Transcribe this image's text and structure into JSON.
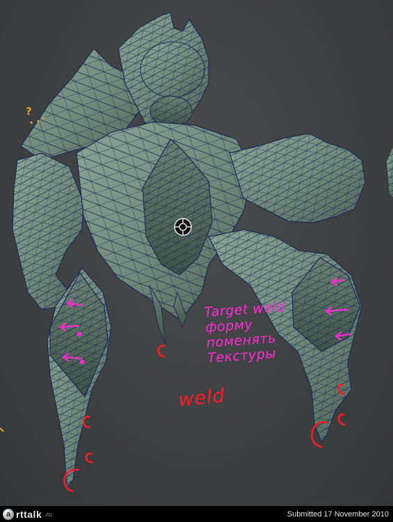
{
  "annotations": {
    "question_mark": "?",
    "target_weld_lines": [
      "Target weld",
      "форму",
      "поменять",
      "Текстуры"
    ],
    "weld": "weld",
    "c_mark": "c"
  },
  "footer": {
    "logo_initial": "a",
    "logo_name": "rttalk",
    "logo_tld": ".ru",
    "submitted": "Submitted 17 November 2010"
  },
  "colors": {
    "mesh_fill": "#6f8a7b",
    "wire": "#1c2a55",
    "annotation_magenta": "#ff2bd6",
    "annotation_red": "#ff1a24"
  }
}
